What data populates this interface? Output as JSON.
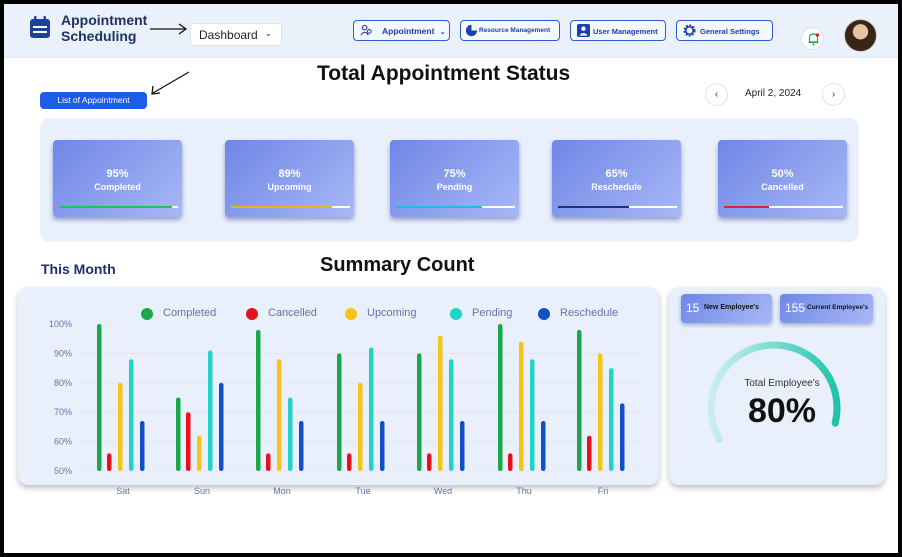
{
  "header": {
    "app_title": "Appointment Scheduling",
    "dashboard_select": "Dashboard",
    "nav": [
      {
        "label": "Appointment",
        "icon": "people-icon"
      },
      {
        "label": "Resource Management",
        "icon": "pie-icon"
      },
      {
        "label": "User Management",
        "icon": "user-icon"
      },
      {
        "label": "General Settings",
        "icon": "gear-icon"
      }
    ]
  },
  "status": {
    "title": "Total Appointment Status",
    "list_button": "List of Appointment",
    "date": "April 2, 2024",
    "cards": [
      {
        "percent": "95%",
        "label": "Completed",
        "fill": 0.95,
        "color": "#1ec45a"
      },
      {
        "percent": "89%",
        "label": "Upcoming",
        "fill": 0.85,
        "color": "#e8b51a"
      },
      {
        "percent": "75%",
        "label": "Pending",
        "fill": 0.72,
        "color": "#1fb8f0"
      },
      {
        "percent": "65%",
        "label": "Reschedule",
        "fill": 0.6,
        "color": "#1d3576"
      },
      {
        "percent": "50%",
        "label": "Cancelled",
        "fill": 0.38,
        "color": "#e0203a"
      }
    ]
  },
  "summary": {
    "this_month": "This Month",
    "title": "Summary Count"
  },
  "employees": {
    "new_count": "15",
    "new_label": "New Employee's",
    "current_count": "155",
    "current_label": "Current Employee's",
    "total_label": "Total Employee's",
    "total_percent": "80%",
    "gauge_fraction": 0.8
  },
  "chart_data": {
    "type": "bar",
    "categories": [
      "Sat",
      "Sun",
      "Mon",
      "Tue",
      "Wed",
      "Thu",
      "Fri"
    ],
    "y_ticks": [
      "50%",
      "60%",
      "70%",
      "80%",
      "90%",
      "100%"
    ],
    "ylim": [
      50,
      100
    ],
    "series": [
      {
        "name": "Completed",
        "color": "#1aa84a",
        "values": [
          100,
          75,
          98,
          90,
          90,
          100,
          98
        ]
      },
      {
        "name": "Cancelled",
        "color": "#e8101c",
        "values": [
          56,
          70,
          56,
          56,
          56,
          56,
          62
        ]
      },
      {
        "name": "Upcoming",
        "color": "#f4c514",
        "values": [
          80,
          62,
          88,
          80,
          96,
          94,
          90
        ]
      },
      {
        "name": "Pending",
        "color": "#22d3c8",
        "values": [
          88,
          91,
          75,
          92,
          88,
          88,
          85
        ]
      },
      {
        "name": "Reschedule",
        "color": "#1150c8",
        "values": [
          67,
          80,
          67,
          67,
          67,
          67,
          73
        ]
      }
    ]
  }
}
